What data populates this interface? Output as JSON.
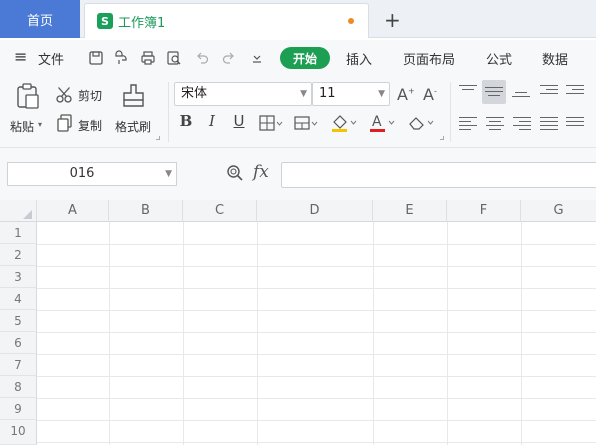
{
  "tabs": {
    "home": "首页",
    "doc_icon": "S",
    "doc_title": "工作簿1",
    "new_tab": "+"
  },
  "menubar": {
    "hamburger": "≡",
    "file": "文件",
    "quick_access": [
      "save-icon",
      "format-painter-icon",
      "print-icon",
      "print-preview-icon",
      "undo-icon",
      "redo-icon",
      "more-icon"
    ],
    "items": [
      "开始",
      "插入",
      "页面布局",
      "公式",
      "数据"
    ]
  },
  "ribbon": {
    "paste": "粘贴",
    "cut": "剪切",
    "copy": "复制",
    "format_painter": "格式刷",
    "font_name": "宋体",
    "font_size": "11",
    "bold": "B",
    "italic": "I",
    "underline": "U"
  },
  "formula": {
    "cell_ref": "016",
    "fx": "fx",
    "value": ""
  },
  "grid": {
    "columns": [
      "A",
      "B",
      "C",
      "D",
      "E",
      "F",
      "G"
    ],
    "rows": [
      "1",
      "2",
      "3",
      "4",
      "5",
      "6",
      "7",
      "8",
      "9",
      "10"
    ]
  },
  "colors": {
    "home_tab": "#4a7ad6",
    "active_menu": "#1c9f52",
    "doc_tab_text": "#1a9a58",
    "modified_dot": "#f08a24"
  }
}
